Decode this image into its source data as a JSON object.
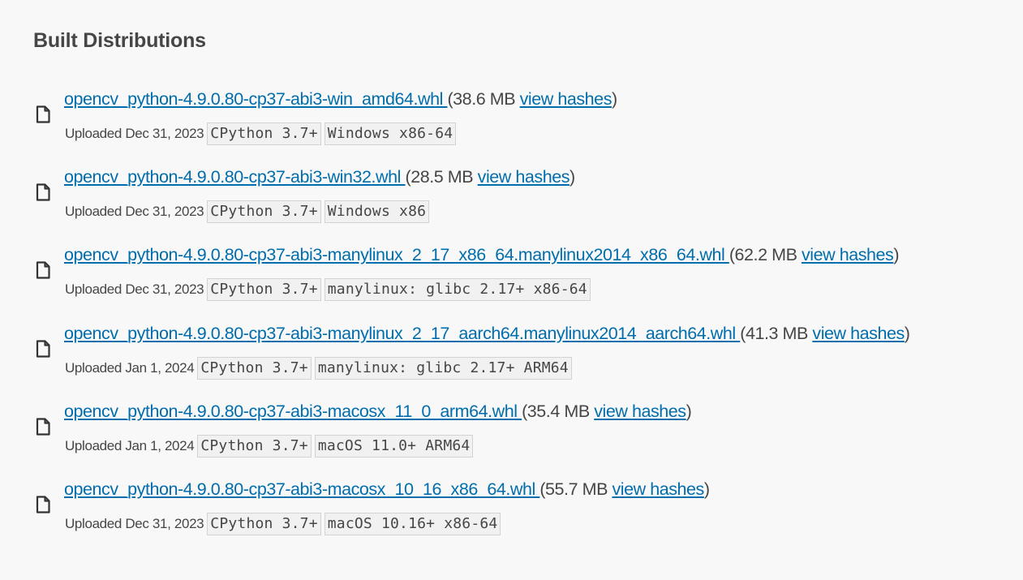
{
  "section": {
    "heading": "Built Distributions"
  },
  "files": [
    {
      "filename": "opencv_python-4.9.0.80-cp37-abi3-win_amd64.whl ",
      "size_prefix": "(38.6 MB ",
      "hashes_label": "view hashes",
      "size_suffix": ")",
      "uploaded": "Uploaded Dec 31, 2023",
      "tags": [
        "CPython 3.7+",
        "Windows x86-64"
      ]
    },
    {
      "filename": "opencv_python-4.9.0.80-cp37-abi3-win32.whl ",
      "size_prefix": "(28.5 MB ",
      "hashes_label": "view hashes",
      "size_suffix": ")",
      "uploaded": "Uploaded Dec 31, 2023",
      "tags": [
        "CPython 3.7+",
        "Windows x86"
      ]
    },
    {
      "filename": "opencv_python-4.9.0.80-cp37-abi3-manylinux_2_17_x86_64.manylinux2014_x86_64.whl ",
      "size_prefix": "(62.2 MB ",
      "hashes_label": "view hashes",
      "size_suffix": ")",
      "uploaded": "Uploaded Dec 31, 2023",
      "tags": [
        "CPython 3.7+",
        "manylinux: glibc 2.17+ x86-64"
      ]
    },
    {
      "filename": "opencv_python-4.9.0.80-cp37-abi3-manylinux_2_17_aarch64.manylinux2014_aarch64.whl ",
      "size_prefix": "(41.3 MB ",
      "hashes_label": "view hashes",
      "size_suffix": ")",
      "uploaded": "Uploaded Jan 1, 2024",
      "tags": [
        "CPython 3.7+",
        "manylinux: glibc 2.17+ ARM64"
      ]
    },
    {
      "filename": "opencv_python-4.9.0.80-cp37-abi3-macosx_11_0_arm64.whl ",
      "size_prefix": "(35.4 MB ",
      "hashes_label": "view hashes",
      "size_suffix": ")",
      "uploaded": "Uploaded Jan 1, 2024",
      "tags": [
        "CPython 3.7+",
        "macOS 11.0+ ARM64"
      ]
    },
    {
      "filename": "opencv_python-4.9.0.80-cp37-abi3-macosx_10_16_x86_64.whl ",
      "size_prefix": "(55.7 MB ",
      "hashes_label": "view hashes",
      "size_suffix": ")",
      "uploaded": "Uploaded Dec 31, 2023",
      "tags": [
        "CPython 3.7+",
        "macOS 10.16+ x86-64"
      ]
    }
  ],
  "icons": {
    "file": "file-icon"
  },
  "colors": {
    "link": "#006dad",
    "text": "#464646",
    "background": "#f8f8f8",
    "tag_background": "#f1f1f1",
    "tag_border": "#d3d3d3"
  }
}
